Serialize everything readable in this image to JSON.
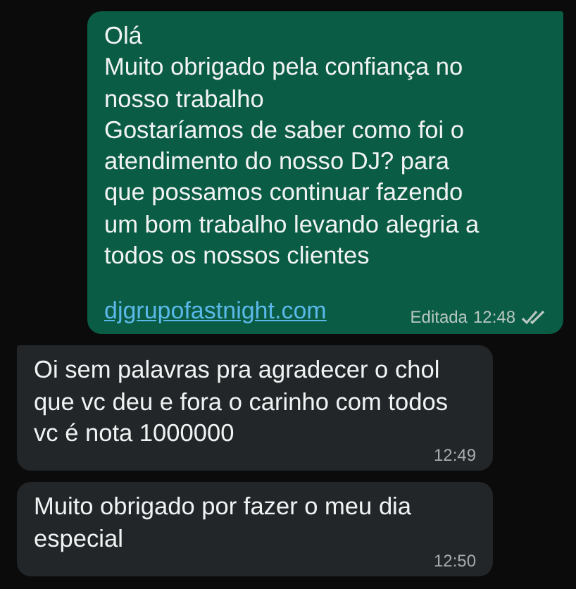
{
  "messages": [
    {
      "kind": "outgoing",
      "tail": true,
      "text": "Olá\nMuito obrigado pela confiança no nosso trabalho\nGostaríamos de saber como foi o atendimento do nosso DJ? para que possamos continuar fazendo um bom trabalho levando alegria a todos os nossos clientes",
      "link": "djgrupofastnight.com",
      "edited_label": "Editada",
      "time": "12:48",
      "read": false
    },
    {
      "kind": "incoming",
      "tail": true,
      "text": "Oi sem palavras pra agradecer o chol que vc deu e fora o carinho com todos vc é nota 1000000",
      "time": "12:49"
    },
    {
      "kind": "incoming",
      "tail": false,
      "text": "Muito obrigado por fazer o meu dia especial",
      "time": "12:50"
    }
  ]
}
